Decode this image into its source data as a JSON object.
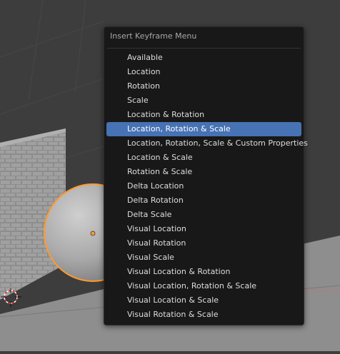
{
  "menu": {
    "title": "Insert Keyframe Menu",
    "highlighted_index": 5,
    "items": [
      {
        "label": "Available"
      },
      {
        "label": "Location"
      },
      {
        "label": "Rotation"
      },
      {
        "label": "Scale"
      },
      {
        "label": "Location & Rotation"
      },
      {
        "label": "Location, Rotation & Scale"
      },
      {
        "label": "Location, Rotation, Scale & Custom Properties"
      },
      {
        "label": "Location & Scale"
      },
      {
        "label": "Rotation & Scale"
      },
      {
        "label": "Delta Location"
      },
      {
        "label": "Delta Rotation"
      },
      {
        "label": "Delta Scale"
      },
      {
        "label": "Visual Location"
      },
      {
        "label": "Visual Rotation"
      },
      {
        "label": "Visual Scale"
      },
      {
        "label": "Visual Location & Rotation"
      },
      {
        "label": "Visual Location, Rotation & Scale"
      },
      {
        "label": "Visual Location & Scale"
      },
      {
        "label": "Visual Rotation & Scale"
      }
    ]
  },
  "colors": {
    "viewport_bg": "#3d3d3d",
    "menu_bg": "#181818",
    "highlight": "#4772b3",
    "selection_outline": "#ff9a2e"
  },
  "icons": {
    "cursor": "3d-cursor-icon",
    "origin": "object-origin-icon"
  }
}
